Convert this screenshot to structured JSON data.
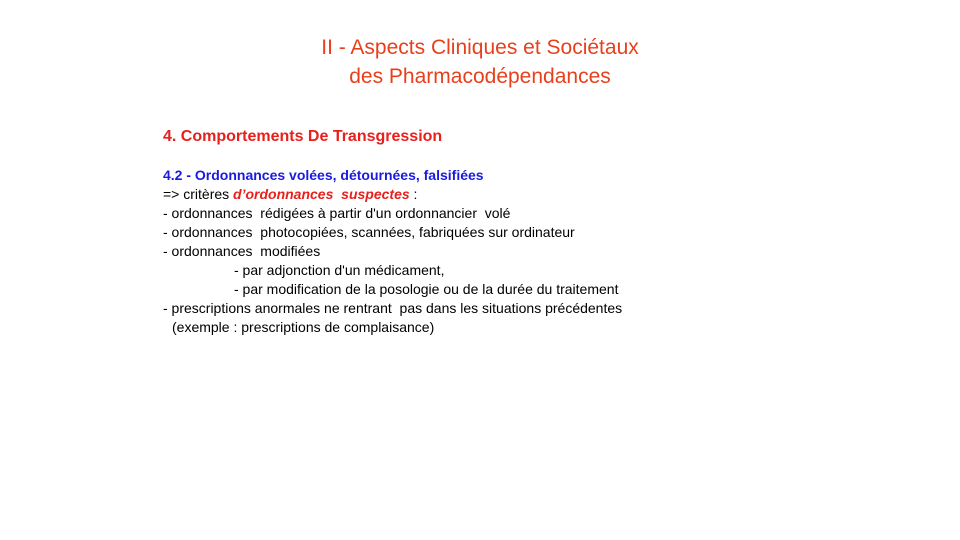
{
  "slide": {
    "title_line1": "II - Aspects Cliniques et Sociétaux",
    "title_line2": "des Pharmacodépendances",
    "section_heading": "4. Comportements De Transgression",
    "subsection_heading": "4.2 - Ordonnances volées, détournées, falsifiées",
    "criteria": {
      "prefix": "=> critères ",
      "emphasis": "d’ordonnances  suspectes",
      "suffix": " :"
    },
    "lines": [
      "- ordonnances  rédigées à partir d'un ordonnancier  volé",
      "- ordonnances  photocopiées, scannées, fabriquées sur ordinateur",
      "- ordonnances  modifiées"
    ],
    "sub_lines": [
      "- par adjonction d'un médicament,",
      "- par modification de la posologie ou de la durée du traitement"
    ],
    "last_line": "- prescriptions anormales ne rentrant  pas dans les situations précédentes",
    "example_line": "(exemple : prescriptions de complaisance)"
  },
  "colors": {
    "title": "#e8401c",
    "heading_red": "#e8201c",
    "heading_blue": "#1a1ae0",
    "text": "#000000"
  }
}
